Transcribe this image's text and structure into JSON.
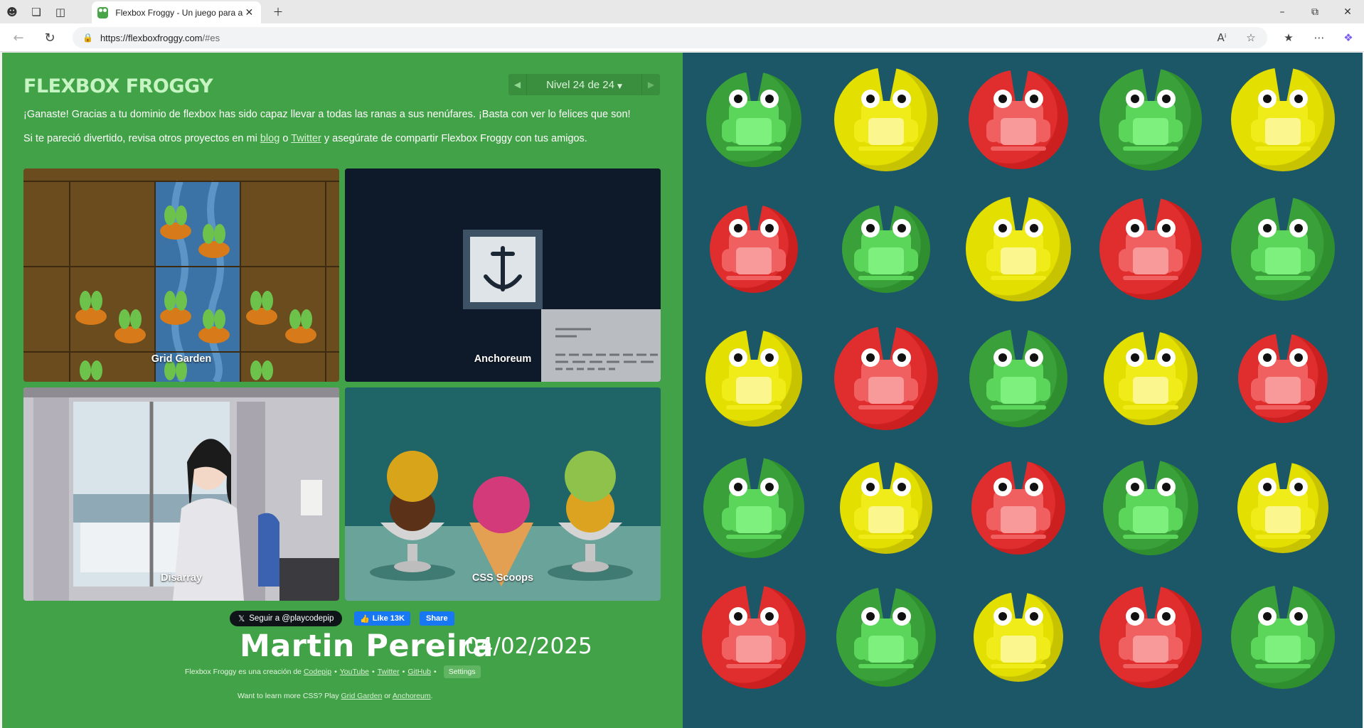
{
  "browser": {
    "tab_title": "Flexbox Froggy - Un juego para aprender CSS flexbox",
    "url_host": "https://flexboxfroggy.com",
    "url_path": "/#es"
  },
  "header": {
    "logo": "FLEXBOX FROGGY",
    "level_label": "Nivel 24 de 24"
  },
  "instructions": {
    "p1": "¡Ganaste! Gracias a tu dominio de flexbox has sido capaz llevar a todas las ranas a sus nenúfares. ¡Basta con ver lo felices que son!",
    "p2_before": "Si te pareció divertido, revisa otros proyectos en mi",
    "p2_link1": "blog",
    "p2_mid": "o",
    "p2_link2": "Twitter",
    "p2_after": "y asegúrate de compartir Flexbox Froggy con tus amigos."
  },
  "promos": [
    {
      "label": "Grid Garden"
    },
    {
      "label": "Anchoreum"
    },
    {
      "label": "Disarray"
    },
    {
      "label": "CSS Scoops"
    }
  ],
  "social": {
    "follow": "Seguir a @playcodepip",
    "like": "Like 13K",
    "share": "Share"
  },
  "signature": {
    "name": "Martin Pereira",
    "date": "04/02/2025"
  },
  "footer": {
    "credit_prefix": "Flexbox Froggy es una creación de",
    "links": [
      "Codepip",
      "YouTube",
      "Twitter",
      "GitHub"
    ],
    "settings": "Settings",
    "learn_prefix": "Want to learn more CSS? Play",
    "learn_link1": "Grid Garden",
    "learn_mid": "or",
    "learn_link2": "Anchoreum",
    "learn_end": "."
  },
  "pond": {
    "colors": {
      "green": {
        "pad": "#2f8f2f",
        "pad_light": "#3aa13a",
        "frog": "#5bd65b",
        "belly": "#7ef07e"
      },
      "yellow": {
        "pad": "#c8c300",
        "pad_light": "#e3df00",
        "frog": "#f0ec1a",
        "belly": "#fbf68e"
      },
      "red": {
        "pad": "#cc1f1f",
        "pad_light": "#e02d2d",
        "frog": "#f06060",
        "belly": "#f89a9a"
      }
    },
    "rows": [
      [
        "green",
        "yellow",
        "red",
        "green",
        "yellow"
      ],
      [
        "red",
        "green",
        "yellow",
        "red",
        "green"
      ],
      [
        "yellow",
        "red",
        "green",
        "yellow",
        "red"
      ],
      [
        "green",
        "yellow",
        "red",
        "green",
        "yellow"
      ],
      [
        "red",
        "green",
        "yellow",
        "red",
        "green"
      ]
    ]
  }
}
